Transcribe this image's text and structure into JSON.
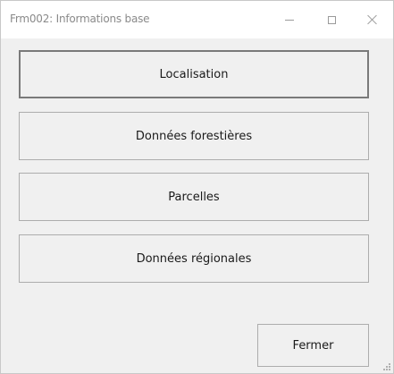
{
  "window": {
    "title": "Frm002: Informations base"
  },
  "buttons": {
    "localisation": "Localisation",
    "donnees_forestieres": "Données forestières",
    "parcelles": "Parcelles",
    "donnees_regionales": "Données régionales",
    "fermer": "Fermer"
  },
  "icons": {
    "minimize": "minimize-icon",
    "maximize": "maximize-icon",
    "close": "close-icon",
    "grip": "resize-grip-icon"
  },
  "colors": {
    "window_bg": "#f0f0f0",
    "titlebar_bg": "#ffffff",
    "button_border": "#adadad",
    "focused_border": "#7a7a7a",
    "title_text": "#8a8a8a"
  }
}
